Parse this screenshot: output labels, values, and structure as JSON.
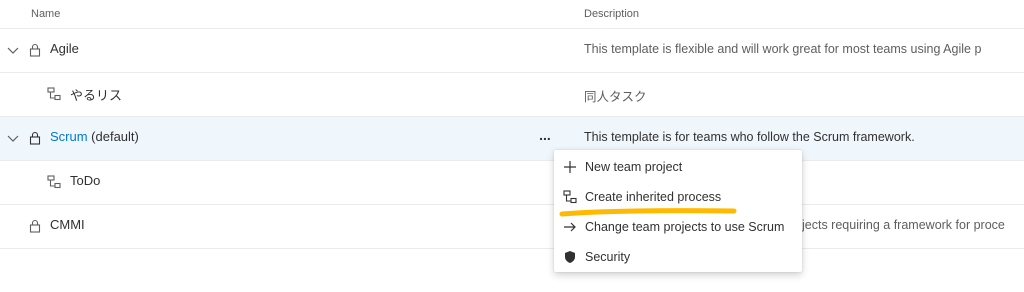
{
  "table": {
    "headers": {
      "name": "Name",
      "description": "Description"
    },
    "rows": [
      {
        "name": "Agile",
        "suffix": "",
        "description": "This template is flexible and will work great for most teams using Agile p"
      },
      {
        "name": "やるリス",
        "suffix": "",
        "description": "同人タスク"
      },
      {
        "name": "Scrum",
        "suffix": " (default)",
        "description": "This template is for teams who follow the Scrum framework."
      },
      {
        "name": "ToDo",
        "suffix": "",
        "description": ""
      },
      {
        "name": "CMMI",
        "suffix": "",
        "description": "jects requiring a framework for proce"
      }
    ]
  },
  "more_button": {
    "label": "..."
  },
  "context_menu": {
    "items": [
      {
        "label": "New team project",
        "icon": "plus-icon"
      },
      {
        "label": "Create inherited process",
        "icon": "inherited-process-icon"
      },
      {
        "label": "Change team projects to use Scrum",
        "icon": "arrow-right-icon"
      },
      {
        "label": "Security",
        "icon": "shield-icon"
      }
    ]
  },
  "colors": {
    "accent_link": "#0078d4",
    "selected_row_bg": "#eff6fc",
    "highlight_stroke": "#ffb900"
  }
}
